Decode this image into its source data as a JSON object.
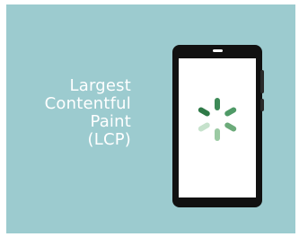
{
  "caption": {
    "line1": "Largest",
    "line2": "Contentful",
    "line3": "Paint",
    "line4": "(LCP)"
  },
  "colors": {
    "background": "#9ccbcf",
    "phone": "#111111",
    "screen": "#ffffff",
    "spinner_dark": "#3d8a57",
    "spinner_mid": "#7fba8c",
    "spinner_light": "#c6e2cc"
  },
  "icons": {
    "spinner": "loading-spinner-icon"
  }
}
